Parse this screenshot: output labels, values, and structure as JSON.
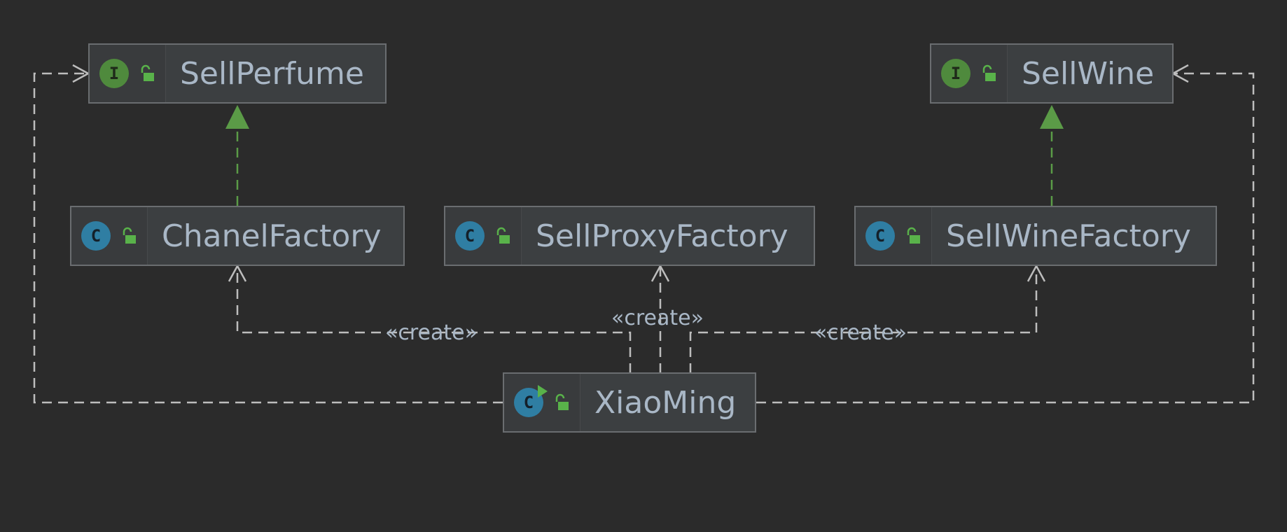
{
  "colors": {
    "background": "#2b2b2b",
    "node_fill": "#3c3f41",
    "node_border": "#6a6d70",
    "text": "#a9b7c6",
    "interface_icon": "#4f8a3d",
    "class_icon": "#2f7ea3",
    "implements_edge": "#5b9b47",
    "dependency_edge": "#bdbdbd"
  },
  "nodes": {
    "sell_perfume": {
      "label": "SellPerfume",
      "kind": "interface",
      "kind_glyph": "I",
      "icon": "interface-icon"
    },
    "sell_wine": {
      "label": "SellWine",
      "kind": "interface",
      "kind_glyph": "I",
      "icon": "interface-icon"
    },
    "chanel_factory": {
      "label": "ChanelFactory",
      "kind": "class",
      "kind_glyph": "C",
      "icon": "class-icon"
    },
    "sell_proxy_factory": {
      "label": "SellProxyFactory",
      "kind": "class",
      "kind_glyph": "C",
      "icon": "class-icon"
    },
    "sell_wine_factory": {
      "label": "SellWineFactory",
      "kind": "class",
      "kind_glyph": "C",
      "icon": "class-icon"
    },
    "xiao_ming": {
      "label": "XiaoMing",
      "kind": "class",
      "kind_glyph": "C",
      "icon": "runnable-class-icon"
    }
  },
  "edges": [
    {
      "from": "chanel_factory",
      "to": "sell_perfume",
      "type": "implements"
    },
    {
      "from": "sell_wine_factory",
      "to": "sell_wine",
      "type": "implements"
    },
    {
      "from": "xiao_ming",
      "to": "sell_perfume",
      "type": "dependency"
    },
    {
      "from": "xiao_ming",
      "to": "sell_wine",
      "type": "dependency"
    },
    {
      "from": "xiao_ming",
      "to": "chanel_factory",
      "type": "dependency",
      "label": "«create»"
    },
    {
      "from": "xiao_ming",
      "to": "sell_proxy_factory",
      "type": "dependency",
      "label": "«create»"
    },
    {
      "from": "xiao_ming",
      "to": "sell_wine_factory",
      "type": "dependency",
      "label": "«create»"
    }
  ],
  "edge_labels": {
    "create_chanel": "«create»",
    "create_proxy": "«create»",
    "create_wine_factory": "«create»"
  }
}
